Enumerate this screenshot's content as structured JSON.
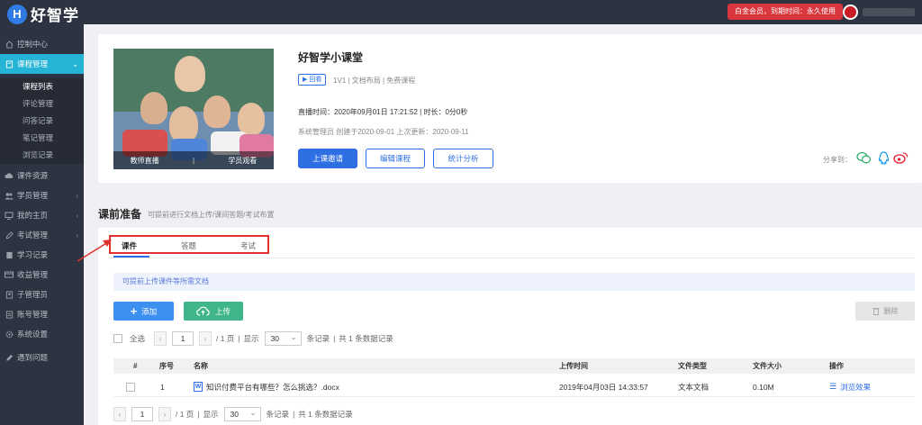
{
  "header": {
    "logo_letter": "H",
    "logo_text": "好智学",
    "member_badge": "白金会员，到期时间：永久使用"
  },
  "sidebar": {
    "items": [
      {
        "label": "控制中心",
        "icon": "home-icon"
      },
      {
        "label": "课程管理",
        "icon": "book-icon",
        "active": true
      },
      {
        "label": "课件资源",
        "icon": "cloud-icon"
      },
      {
        "label": "学员管理",
        "icon": "users-icon"
      },
      {
        "label": "我的主页",
        "icon": "monitor-icon"
      },
      {
        "label": "考试管理",
        "icon": "edit-icon"
      },
      {
        "label": "学习记录",
        "icon": "record-icon"
      },
      {
        "label": "收益管理",
        "icon": "wallet-icon"
      },
      {
        "label": "子管理员",
        "icon": "user-icon"
      },
      {
        "label": "账号管理",
        "icon": "account-icon"
      },
      {
        "label": "系统设置",
        "icon": "gear-icon"
      },
      {
        "label": "遇到问题",
        "icon": "help-icon"
      }
    ],
    "sub_items": [
      "课程列表",
      "评论管理",
      "问答记录",
      "笔记管理",
      "浏览记录"
    ]
  },
  "course": {
    "title": "好智学小课堂",
    "tag": "▶ 回看",
    "meta": "1V1 | 文档布局 | 免费课程",
    "live_info": "直播时间：2020年09月01日 17:21:52 | 时长：0分0秒",
    "creator_info": "系统管理员 创建于2020-09-01 上次更新：2020-09-11",
    "image_overlay_left": "教师直播",
    "image_overlay_right": "学员观看",
    "buttons": {
      "start": "上课邀请",
      "edit": "编辑课程",
      "stats": "统计分析"
    },
    "share_label": "分享到："
  },
  "prep": {
    "title": "课前准备",
    "subtitle": "可提前进行文档上传/课间答题/考试布置",
    "tabs": [
      "课件",
      "答题",
      "考试"
    ],
    "notice": "可提前上传课件等所需文档",
    "btn_add": "添加",
    "btn_upload": "上传",
    "btn_delete": "删除",
    "pager_top": {
      "select_all": "全选",
      "page": "1",
      "total_pages": "/ 1 页",
      "show": "显示",
      "page_size": "30",
      "per_page": "条记录",
      "summary": "共 1 条数据记录"
    },
    "table": {
      "headers": [
        "#",
        "序号",
        "名称",
        "上传时间",
        "文件类型",
        "文件大小",
        "操作"
      ],
      "rows": [
        {
          "index": "1",
          "name": "知识付费平台有哪些？怎么挑选？.docx",
          "time": "2019年04月03日 14:33:57",
          "type": "文本文档",
          "size": "0.10M",
          "action": "浏览效果"
        }
      ]
    },
    "pager_bottom": {
      "page": "1",
      "total_pages": "/ 1 页",
      "show": "显示",
      "page_size": "30",
      "per_page": "条记录",
      "summary": "共 1 条数据记录"
    }
  },
  "colors": {
    "sidebar_bg": "#2d3340",
    "active_nav": "#25b4d6",
    "primary": "#2f6fe4",
    "upload_green": "#3fb58a",
    "badge_red": "#d9363e",
    "highlight_red": "#e03030"
  }
}
